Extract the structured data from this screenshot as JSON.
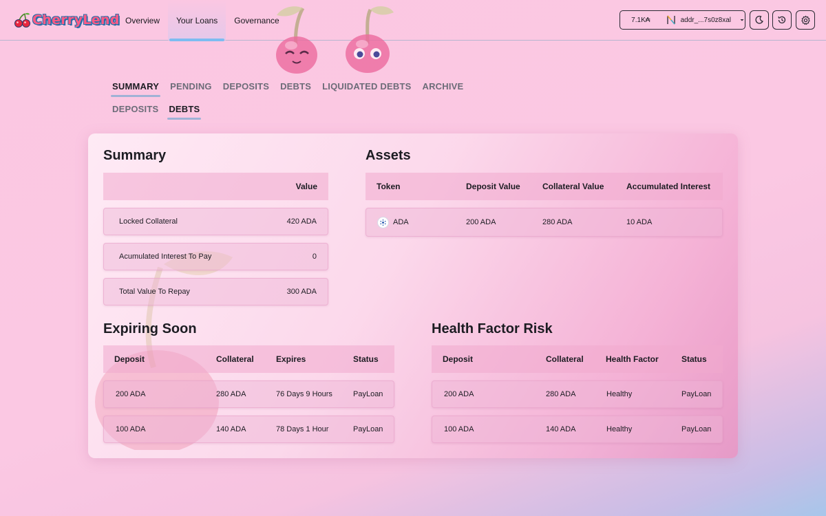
{
  "app": {
    "brand": "CherryLend",
    "nav": [
      "Overview",
      "Your Loans",
      "Governance"
    ],
    "active_nav": "Your Loans"
  },
  "wallet": {
    "balance": "7.1K₳",
    "address": "addr_...7s0z8xal"
  },
  "icons": {
    "logo": "cherry-icon",
    "wallet": "nami-wallet-icon",
    "dropdown": "caret-down-icon",
    "theme": "moon-icon",
    "refresh": "history-icon",
    "settings": "gear-icon",
    "token": "cardano-icon"
  },
  "tabs": [
    "SUMMARY",
    "PENDING",
    "DEPOSITS",
    "DEBTS",
    "LIQUIDATED DEBTS",
    "ARCHIVE"
  ],
  "active_tab": "SUMMARY",
  "subtabs": [
    "DEPOSITS",
    "DEBTS"
  ],
  "active_subtab": "DEBTS",
  "summary": {
    "title": "Summary",
    "header_value": "Value",
    "rows": [
      {
        "label": "Locked Collateral",
        "value": "420 ADA"
      },
      {
        "label": "Acumulated Interest To Pay",
        "value": "0"
      },
      {
        "label": "Total Value To Repay",
        "value": "300 ADA"
      }
    ]
  },
  "assets": {
    "title": "Assets",
    "headers": [
      "Token",
      "Deposit Value",
      "Collateral Value",
      "Accumulated Interest"
    ],
    "rows": [
      {
        "token": "ADA",
        "deposit": "200 ADA",
        "collateral": "280 ADA",
        "interest": "10 ADA"
      }
    ]
  },
  "expiring": {
    "title": "Expiring Soon",
    "headers": [
      "Deposit",
      "Collateral",
      "Expires",
      "Status"
    ],
    "rows": [
      {
        "deposit": "200 ADA",
        "collateral": "280 ADA",
        "expires": "76 Days 9 Hours",
        "status": "PayLoan"
      },
      {
        "deposit": "100 ADA",
        "collateral": "140 ADA",
        "expires": "78 Days 1 Hour",
        "status": "PayLoan"
      }
    ]
  },
  "health": {
    "title": "Health Factor Risk",
    "headers": [
      "Deposit",
      "Collateral",
      "Health Factor",
      "Status"
    ],
    "rows": [
      {
        "deposit": "200 ADA",
        "collateral": "280 ADA",
        "health": "Healthy",
        "status": "PayLoan"
      },
      {
        "deposit": "100 ADA",
        "collateral": "140 ADA",
        "health": "Healthy",
        "status": "PayLoan"
      }
    ]
  },
  "colors": {
    "accent_tab": "#9fb2d6",
    "accent_nav": "#7cbcf1",
    "brand_pink": "#ff5a86",
    "brand_outline": "#2a6fa8"
  }
}
